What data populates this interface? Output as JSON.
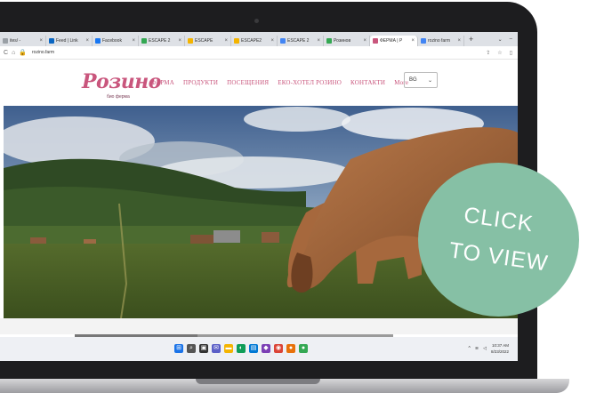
{
  "browser": {
    "tabs": [
      {
        "label": "ites/ -",
        "color": "#9aa0a6"
      },
      {
        "label": "Feed | Link",
        "color": "#0a66c2"
      },
      {
        "label": "Facebook",
        "color": "#1877f2"
      },
      {
        "label": "ESCAPE 2",
        "color": "#34a853"
      },
      {
        "label": "ESCAPE",
        "color": "#f4b400"
      },
      {
        "label": "ESCAPE2",
        "color": "#f4b400"
      },
      {
        "label": "ESCAPE 2",
        "color": "#4285f4"
      },
      {
        "label": "Розинов",
        "color": "#34a853"
      },
      {
        "label": "ФЕРМА | Р",
        "color": "#c9567d"
      },
      {
        "label": "rozino farm",
        "color": "#4285f4"
      }
    ],
    "active_tab_index": 8,
    "url": "rozino.farm"
  },
  "site": {
    "logo": "Розино",
    "logo_sub": "био ферма",
    "nav": [
      "ФЕРМА",
      "ПРОДУКТИ",
      "ПОСЕЩЕНИЯ",
      "ЕКО-ХОТЕЛ РОЗИНО",
      "КОНТАКТИ",
      "More"
    ],
    "language": "BG",
    "accent_color": "#c9567d"
  },
  "taskbar": {
    "time": "10:37 AM",
    "date": "8/23/2022"
  },
  "badge": {
    "line1": "CLICK",
    "line2": "TO VIEW",
    "color": "#86c0a5"
  }
}
